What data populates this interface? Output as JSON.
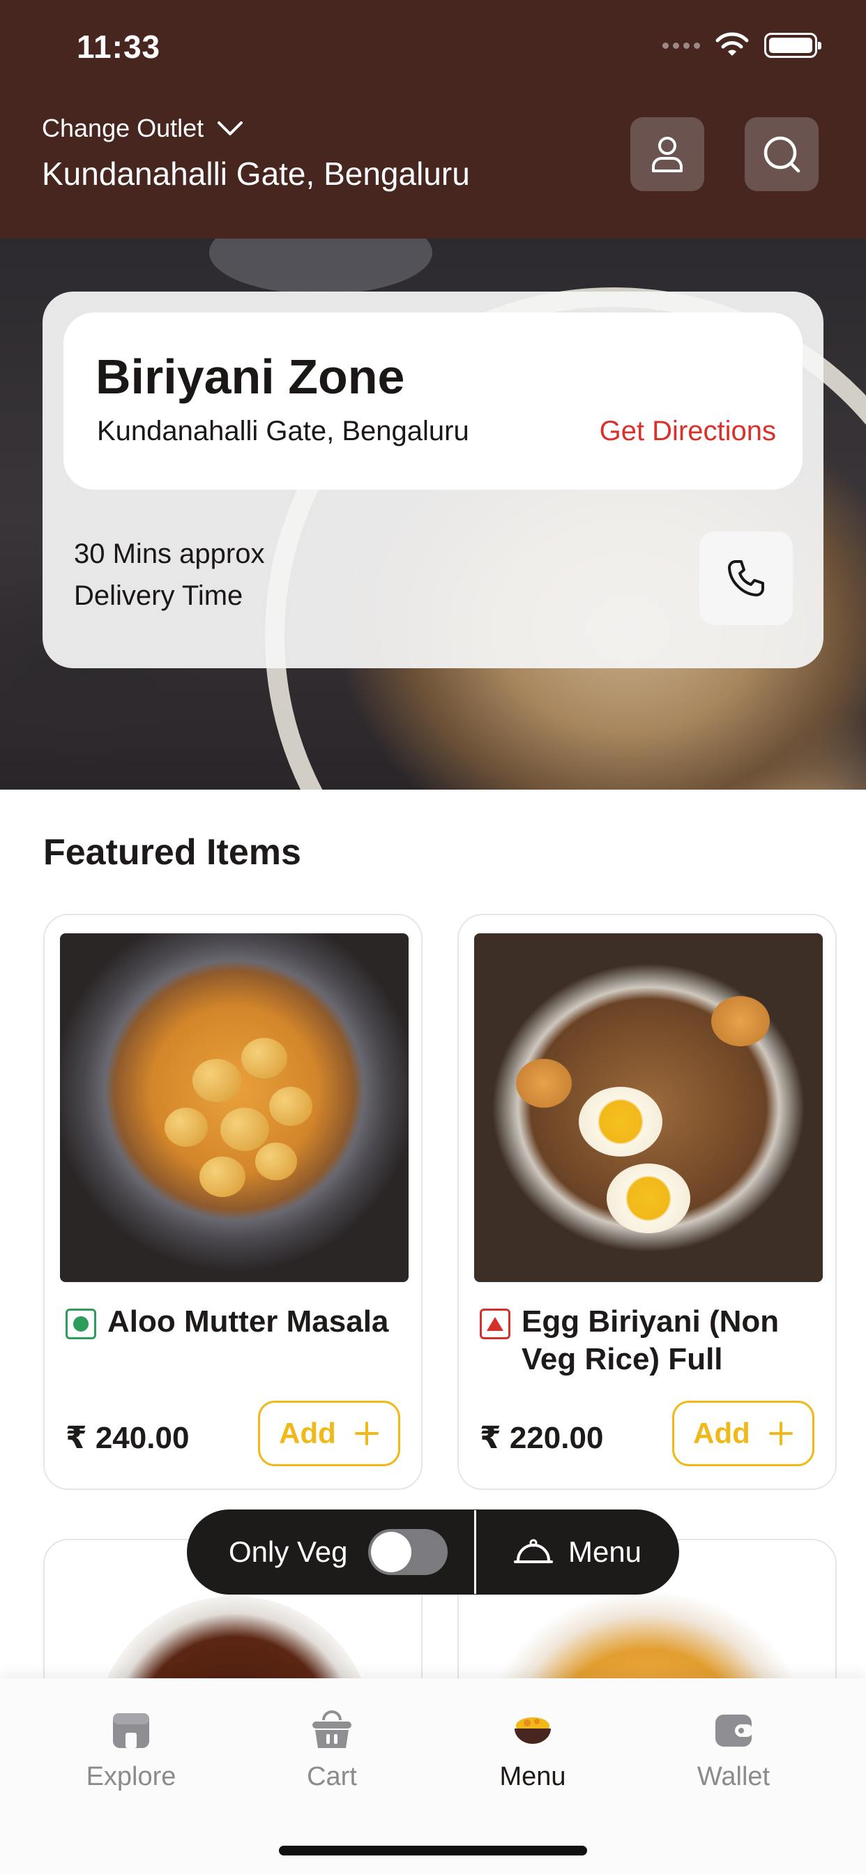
{
  "status_bar": {
    "time": "11:33"
  },
  "header": {
    "change_outlet_label": "Change Outlet",
    "location": "Kundanahalli Gate, Bengaluru",
    "profile_icon": "user-icon",
    "search_icon": "search-icon"
  },
  "restaurant": {
    "name": "Biriyani Zone",
    "address": "Kundanahalli Gate, Bengaluru",
    "directions_label": "Get Directions",
    "delivery_time": "30 Mins approx",
    "delivery_caption": "Delivery Time",
    "call_icon": "phone-icon"
  },
  "featured": {
    "title": "Featured Items",
    "items": [
      {
        "name": "Aloo Mutter Masala",
        "price": "₹ 240.00",
        "type": "veg",
        "add_label": "Add"
      },
      {
        "name": "Egg Biriyani (Non Veg Rice) Full",
        "price": "₹ 220.00",
        "type": "non-veg",
        "add_label": "Add"
      }
    ]
  },
  "floating_bar": {
    "only_veg_label": "Only Veg",
    "only_veg_on": false,
    "menu_label": "Menu"
  },
  "tabs": [
    {
      "label": "Explore",
      "icon": "store-icon",
      "active": false
    },
    {
      "label": "Cart",
      "icon": "basket-icon",
      "active": false
    },
    {
      "label": "Menu",
      "icon": "bowl-icon",
      "active": true
    },
    {
      "label": "Wallet",
      "icon": "wallet-icon",
      "active": false
    }
  ],
  "colors": {
    "header_bg": "#472620",
    "accent_red": "#d9302a",
    "accent_yellow": "#f0b818",
    "veg_green": "#2e9c5b"
  }
}
